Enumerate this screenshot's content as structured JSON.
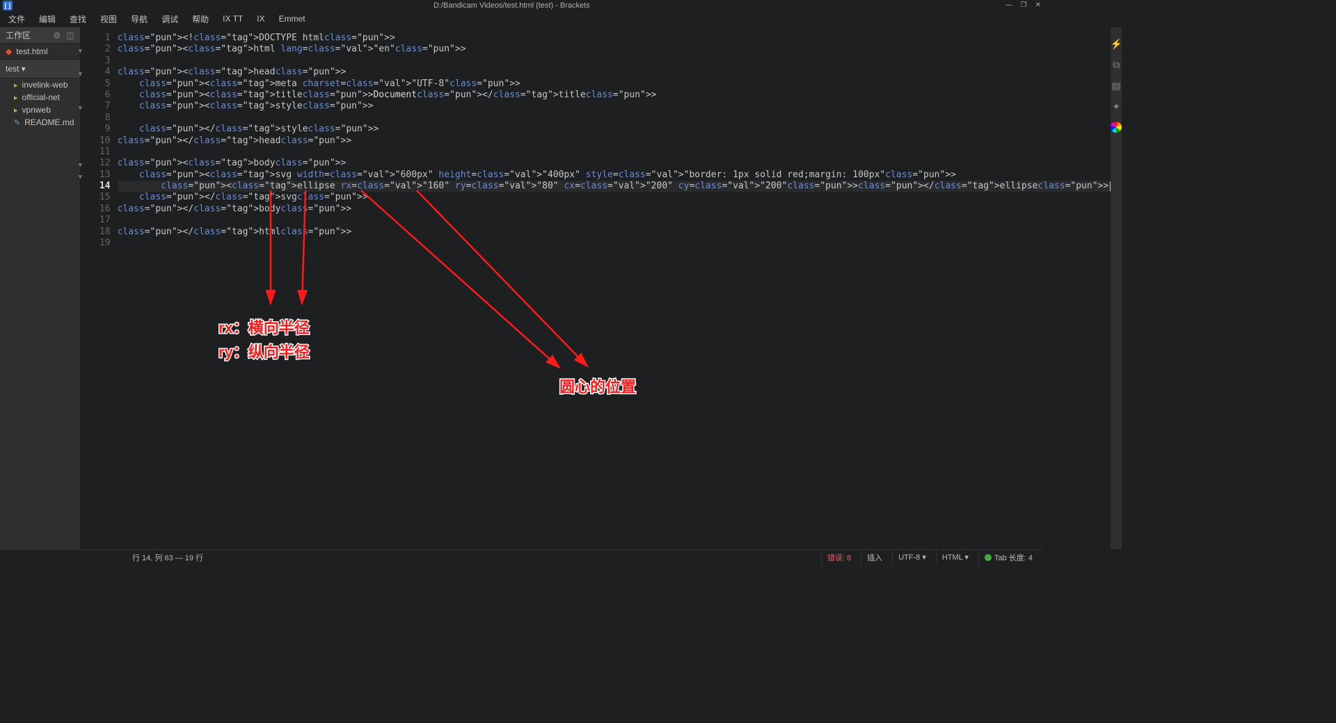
{
  "titlebar": {
    "title": "D:/Bandicam Videos/test.html (test) - Brackets"
  },
  "menu": {
    "items": [
      "文件",
      "编辑",
      "查找",
      "视图",
      "导航",
      "调试",
      "帮助",
      "IX TT",
      "IX",
      "Emmet"
    ]
  },
  "sidebar": {
    "header": "工作区",
    "open_file": "test.html",
    "project_section": "test ▾",
    "folders": [
      "invelink-web",
      "official-net",
      "vpnweb"
    ],
    "readme": "README.md"
  },
  "editor": {
    "line_numbers": [
      "1",
      "2",
      "3",
      "4",
      "5",
      "6",
      "7",
      "8",
      "9",
      "10",
      "11",
      "12",
      "13",
      "14",
      "15",
      "16",
      "17",
      "18",
      "19"
    ],
    "current_line": 14,
    "fold_lines": [
      2,
      4,
      7,
      12,
      13
    ],
    "lines_raw": [
      "<!DOCTYPE html>",
      "<html lang=\"en\">",
      "",
      "<head>",
      "    <meta charset=\"UTF-8\">",
      "    <title>Document</title>",
      "    <style>",
      "        ",
      "    </style>",
      "</head>",
      "",
      "<body>",
      "    <svg width=\"600px\" height=\"400px\" style=\"border: 1px solid red;margin: 100px\">",
      "        <ellipse rx=\"160\" ry=\"80\" cx=\"200\" cy=\"200\"></ellipse>",
      "    </svg>",
      "</body>",
      "",
      "</html>",
      ""
    ]
  },
  "annotations": {
    "rx_label": "rx：横向半径",
    "ry_label": "ry：纵向半径",
    "center_label": "圆心的位置"
  },
  "tabbar": {
    "tab": "test"
  },
  "status": {
    "cursor": "行 14, 列 63 — 19 行",
    "errors": "错误: 8",
    "insert": "插入",
    "encoding": "UTF-8 ▾",
    "lang": "HTML ▾",
    "spaces": "Tab 长度: 4"
  }
}
